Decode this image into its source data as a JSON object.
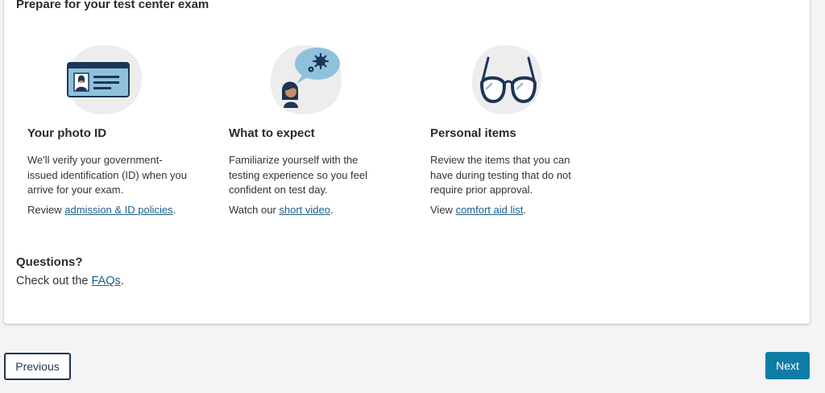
{
  "page": {
    "title": "Prepare for your test center exam"
  },
  "columns": [
    {
      "heading": "Your photo ID",
      "description": "We'll verify your government-issued identification (ID) when you arrive for your exam.",
      "link_prefix": "Review ",
      "link_text": "admission & ID policies",
      "link_suffix": ".",
      "icon": "photo-id-card-icon"
    },
    {
      "heading": "What to expect",
      "description": "Familiarize yourself with the testing experience so you feel confident on test day.",
      "link_prefix": "Watch our ",
      "link_text": "short video",
      "link_suffix": ".",
      "icon": "person-thinking-gears-icon"
    },
    {
      "heading": "Personal items",
      "description": "Review the items that you can have during testing that do not require prior approval.",
      "link_prefix": "View ",
      "link_text": "comfort aid list",
      "link_suffix": ".",
      "icon": "eyeglasses-icon"
    }
  ],
  "questions": {
    "title": "Questions?",
    "text_prefix": "Check out the ",
    "link_text": "FAQs",
    "text_suffix": "."
  },
  "nav": {
    "previous_label": "Previous",
    "next_label": "Next"
  },
  "colors": {
    "accent": "#0f7ca6",
    "link": "#1a5f8a",
    "dark_navy": "#1d3557",
    "illustration_bg": "#ededed"
  }
}
